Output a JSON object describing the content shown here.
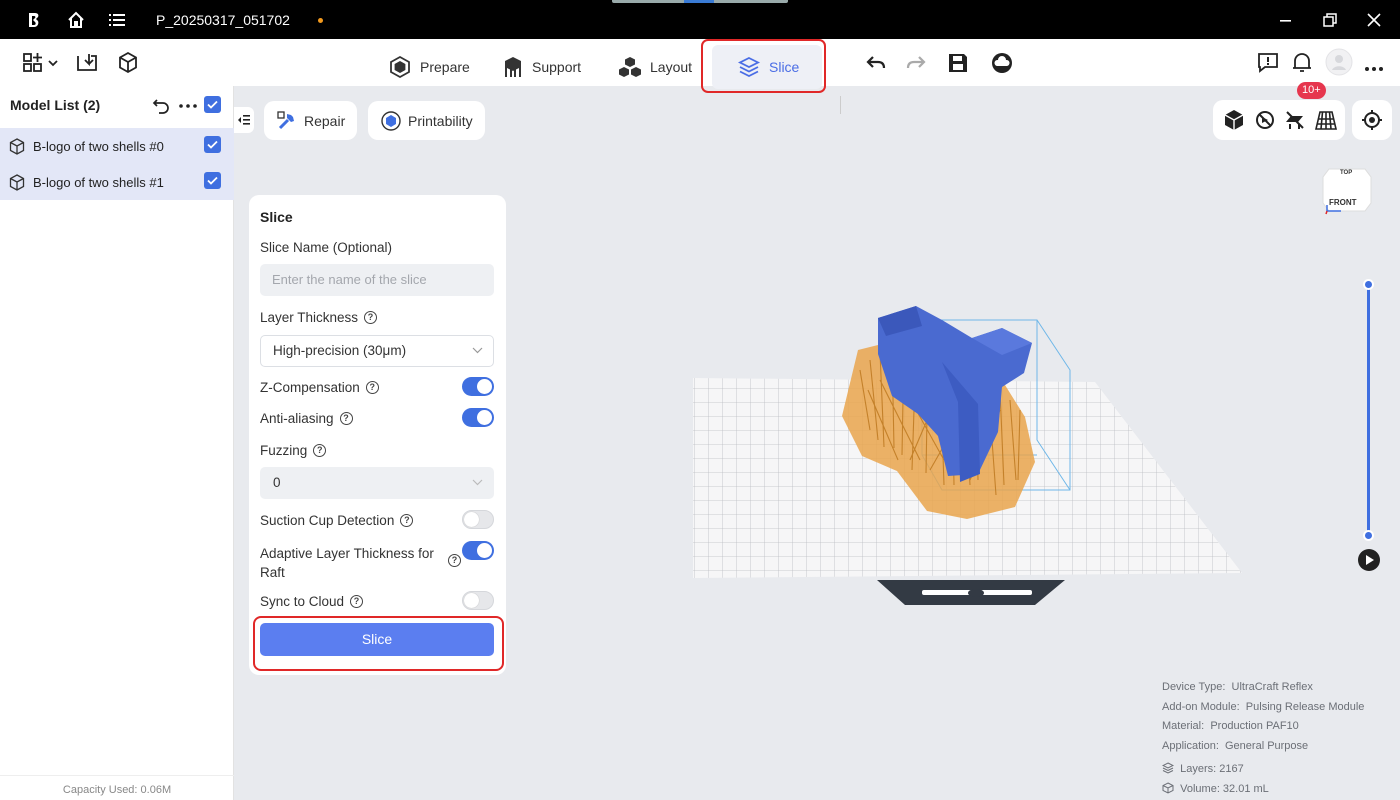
{
  "window": {
    "title": "P_20250317_051702"
  },
  "tabs": [
    {
      "label": "Prepare",
      "icon": "prepare-icon"
    },
    {
      "label": "Support",
      "icon": "support-icon"
    },
    {
      "label": "Layout",
      "icon": "layout-icon"
    },
    {
      "label": "Slice",
      "icon": "slice-icon",
      "active": true
    }
  ],
  "notifications": {
    "badge": "10+"
  },
  "sidebar": {
    "title": "Model List (2)",
    "models": [
      {
        "name": "B-logo of two shells #0",
        "checked": true
      },
      {
        "name": "B-logo of two shells #1",
        "checked": true
      }
    ],
    "capacity": "Capacity Used: 0.06M"
  },
  "actions": {
    "repair": "Repair",
    "printability": "Printability"
  },
  "slice_panel": {
    "title": "Slice",
    "name_label": "Slice Name (Optional)",
    "name_placeholder": "Enter the name of the slice",
    "layer_thickness_label": "Layer Thickness",
    "layer_thickness_value": "High-precision (30μm)",
    "z_comp_label": "Z-Compensation",
    "z_comp_on": true,
    "anti_alias_label": "Anti-aliasing",
    "anti_alias_on": true,
    "fuzzing_label": "Fuzzing",
    "fuzzing_value": "0",
    "suction_label": "Suction Cup Detection",
    "suction_on": false,
    "adaptive_label_1": "Adaptive Layer Thickness for",
    "adaptive_label_2": "Raft",
    "adaptive_on": true,
    "sync_label": "Sync to Cloud",
    "sync_on": false,
    "slice_button": "Slice"
  },
  "viewcube": {
    "top": "TOP",
    "front": "FRONT"
  },
  "info": {
    "device_type_label": "Device Type:",
    "device_type": "UltraCraft Reflex",
    "addon_label": "Add-on Module:",
    "addon": "Pulsing Release Module",
    "material_label": "Material:",
    "material": "Production PAF10",
    "application_label": "Application:",
    "application": "General Purpose",
    "layers": "Layers: 2167",
    "volume": "Volume: 32.01 mL"
  },
  "colors": {
    "accent": "#3f6fe0",
    "highlight": "#e02828",
    "model": "#4a6ad0",
    "support": "#e9a44c"
  }
}
